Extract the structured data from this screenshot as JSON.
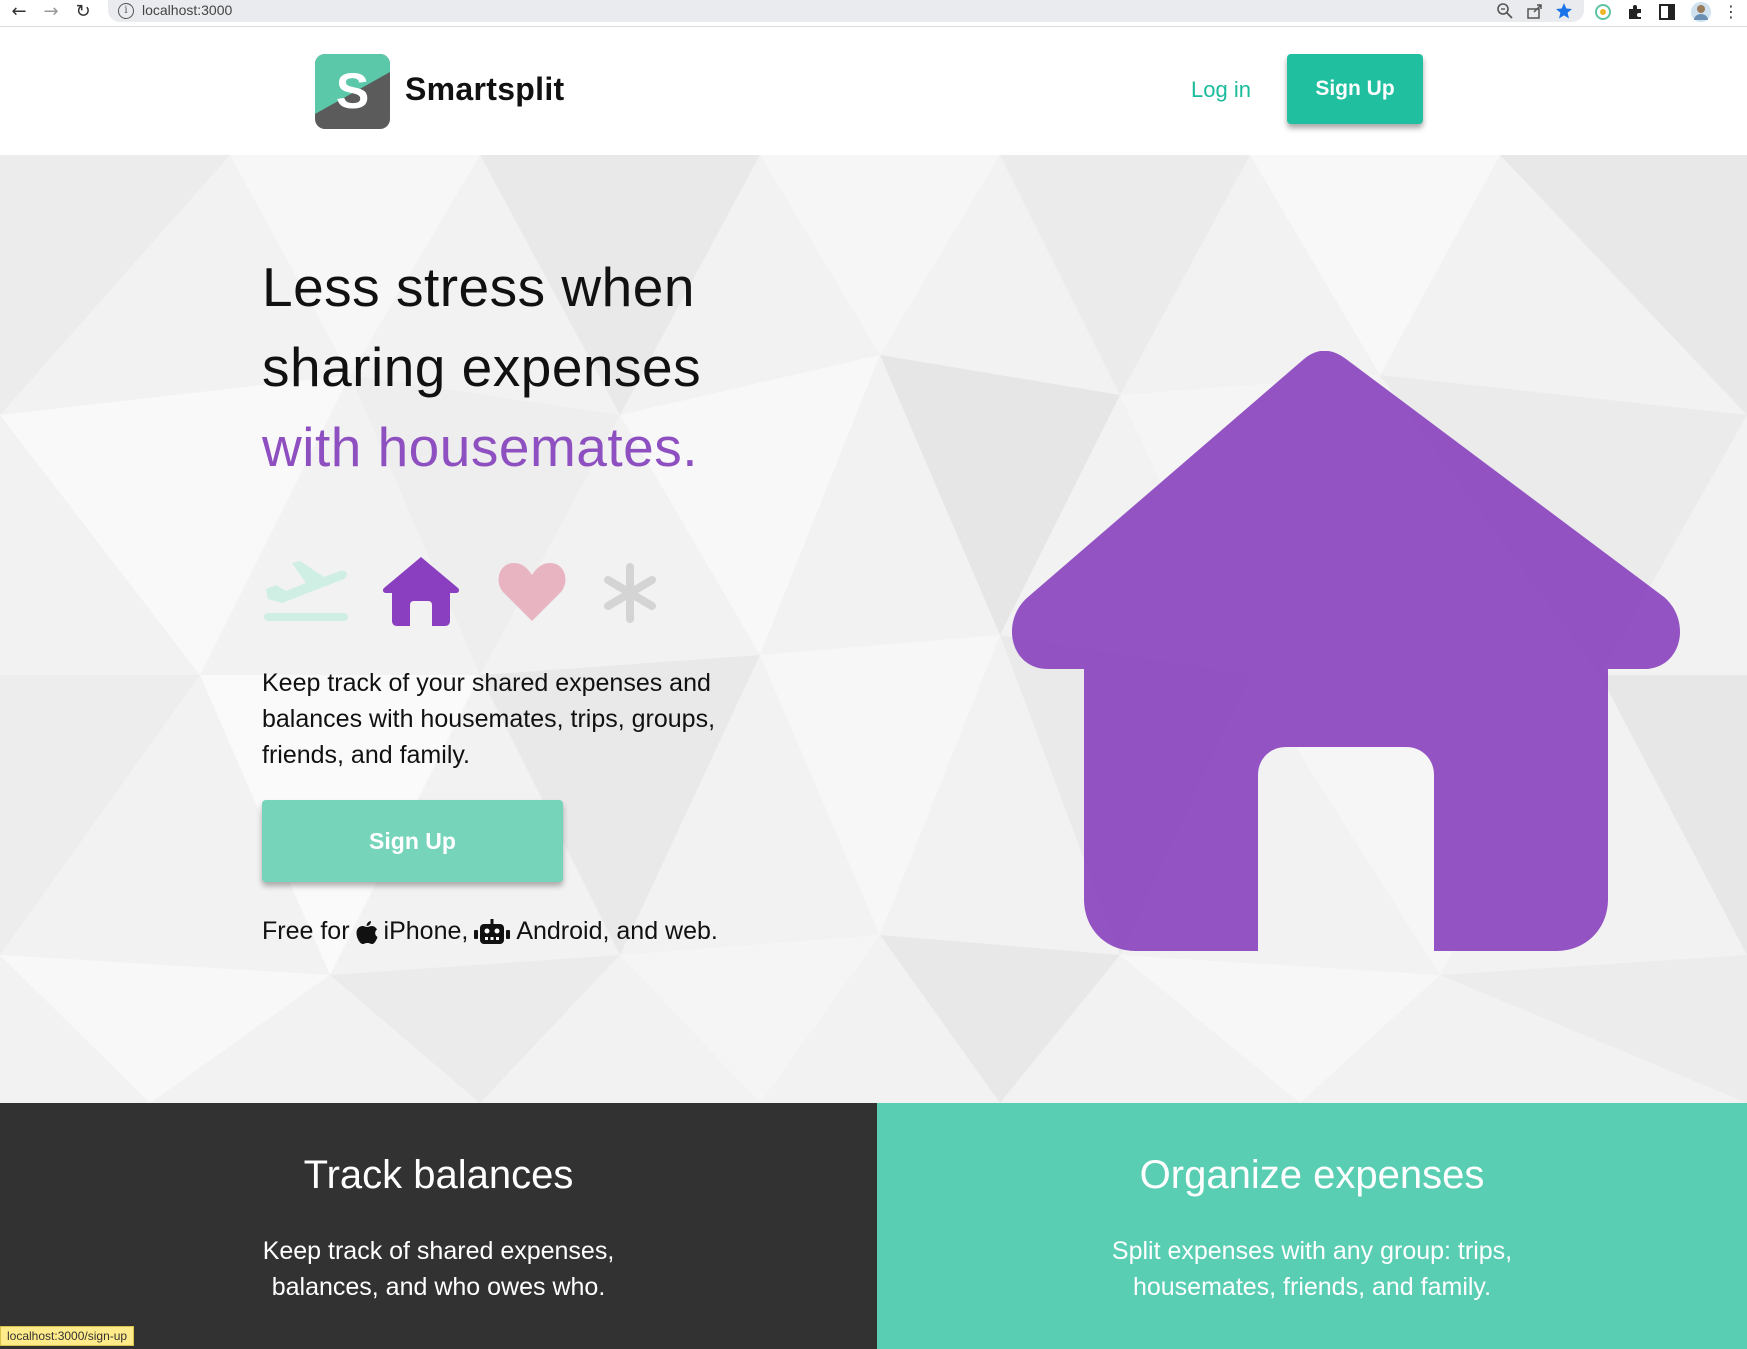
{
  "browser": {
    "url": "localhost:3000"
  },
  "header": {
    "brand_letter": "S",
    "brand_name": "Smartsplit",
    "login_label": "Log in",
    "signup_label": "Sign Up"
  },
  "hero": {
    "headline_line1": "Less stress when",
    "headline_line2": "sharing expenses",
    "headline_line3": "with housemates.",
    "category_icons": [
      "plane-icon",
      "house-icon",
      "heart-icon",
      "asterisk-icon"
    ],
    "description": "Keep track of your shared expenses and balances with housemates, trips, groups, friends, and family.",
    "signup_label": "Sign Up",
    "free_prefix": "Free for",
    "free_iphone": "iPhone,",
    "free_android": "Android, and web."
  },
  "features": {
    "left": {
      "title": "Track balances",
      "text_line1": "Keep track of shared expenses,",
      "text_line2": "balances, and who owes who."
    },
    "right": {
      "title": "Organize expenses",
      "text_line1": "Split expenses with any group: trips,",
      "text_line2": "housemates, friends, and family."
    }
  },
  "status_bar": {
    "link": "localhost:3000/sign-up"
  },
  "colors": {
    "accent_teal": "#1fbf9f",
    "hero_button": "#76d4bb",
    "purple": "#8e4fc0",
    "dark_panel": "#323232",
    "teal_panel": "#59ceb3"
  }
}
